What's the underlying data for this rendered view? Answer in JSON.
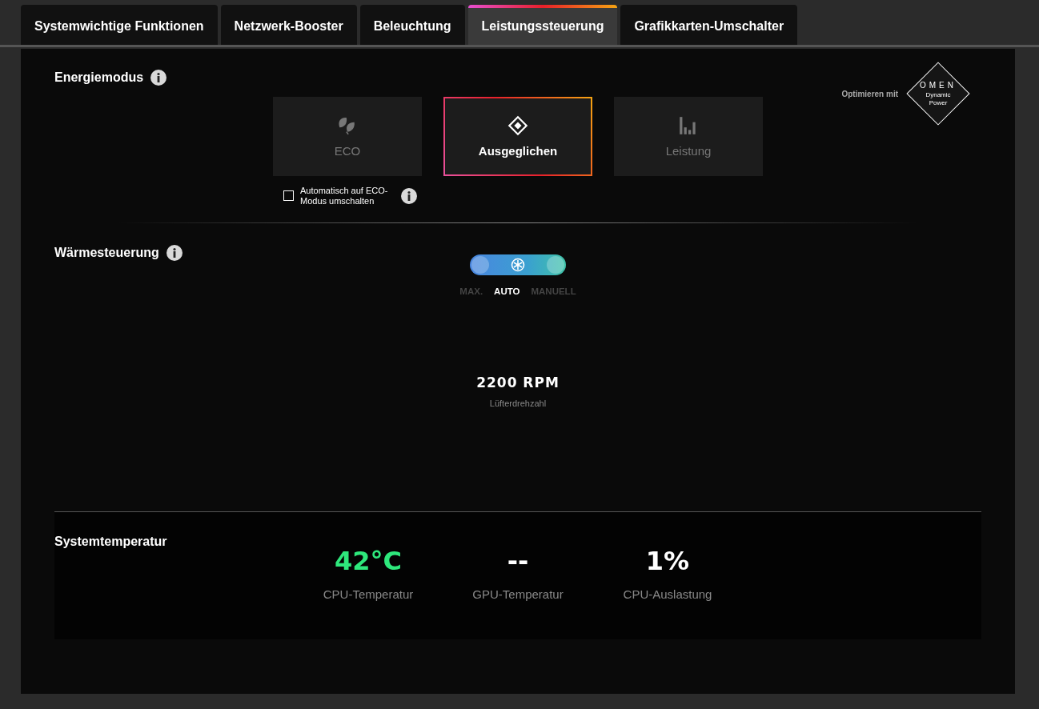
{
  "tabs": [
    {
      "label": "Systemwichtige Funktionen",
      "selected": false
    },
    {
      "label": "Netzwerk-Booster",
      "selected": false
    },
    {
      "label": "Beleuchtung",
      "selected": false
    },
    {
      "label": "Leistungssteuerung",
      "selected": true
    },
    {
      "label": "Grafikkarten-Umschalter",
      "selected": false
    }
  ],
  "energy": {
    "title": "Energiemodus",
    "optimize_label": "Optimieren mit",
    "logo": {
      "brand": "OMEN",
      "line_1": "Dynamic",
      "line_2": "Power"
    },
    "modes": [
      {
        "label": "ECO",
        "kind": "leaf",
        "selected": false
      },
      {
        "label": "Ausgeglichen",
        "kind": "diamond",
        "selected": true
      },
      {
        "label": "Leistung",
        "kind": "bars",
        "selected": false
      }
    ],
    "auto_eco": {
      "label": "Automatisch auf ECO-Modus umschalten",
      "checked": false
    }
  },
  "thermal": {
    "title": "Wärmesteuerung",
    "options": [
      {
        "label": "MAX.",
        "selected": false
      },
      {
        "label": "AUTO",
        "selected": true
      },
      {
        "label": "MANUELL",
        "selected": false
      }
    ],
    "fan_speed": "2200 RPM",
    "fan_label": "Lüfterdrehzahl"
  },
  "system_temp": {
    "title": "Systemtemperatur",
    "stats": [
      {
        "value": "42°C",
        "label": "CPU-Temperatur",
        "color": "#2ee87c"
      },
      {
        "value": "--",
        "label": "GPU-Temperatur",
        "color": "#ffffff"
      },
      {
        "value": "1%",
        "label": "CPU-Auslastung",
        "color": "#ffffff"
      }
    ]
  }
}
